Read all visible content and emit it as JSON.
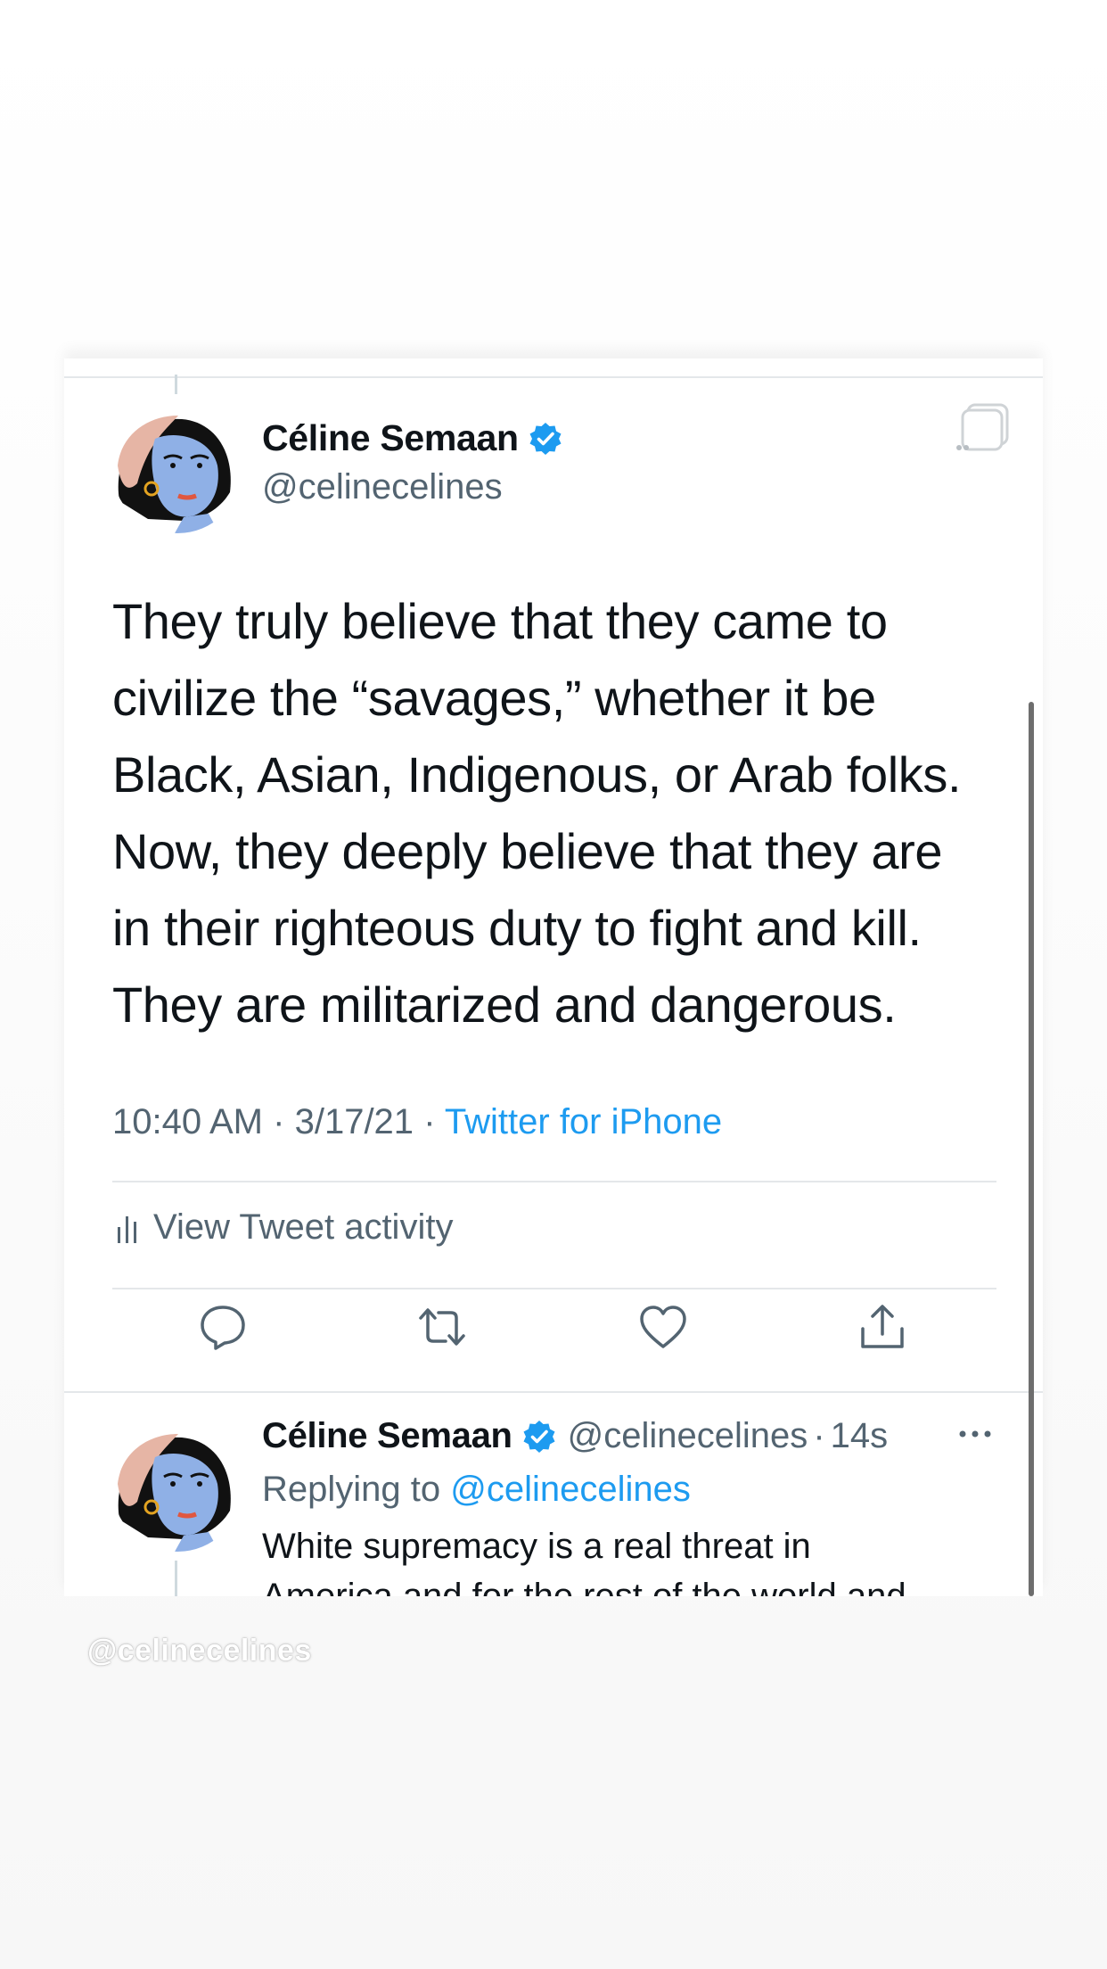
{
  "main_tweet": {
    "author": {
      "display_name": "Céline Semaan",
      "handle": "@celinecelines",
      "verified": true,
      "avatar_icon": "illustrated-portrait-avatar"
    },
    "text_lines": [
      "They truly believe that they came to",
      "civilize the “savages,” whether it be",
      "Black, Asian, Indigenous, or Arab folks.",
      "Now, they deeply believe that they are",
      "in their righteous duty to fight and kill.",
      "They are militarized and dangerous."
    ],
    "time": "10:40 AM",
    "date": "3/17/21",
    "separator": "·",
    "source": "Twitter for iPhone",
    "activity_label": "View Tweet activity",
    "actions": [
      "reply-icon",
      "retweet-icon",
      "like-icon",
      "share-icon"
    ]
  },
  "reply_tweet": {
    "author": {
      "display_name": "Céline Semaan",
      "handle": "@celinecelines",
      "verified": true
    },
    "separator": "·",
    "time_ago": "14s",
    "replying_prefix": "Replying to",
    "replying_to": "@celinecelines",
    "text_visible": "White supremacy is a real threat in",
    "text_cut": "America and for the rest of the world and"
  },
  "watermark": "@celinecelines",
  "colors": {
    "accent": "#1d9bf0",
    "secondary_text": "#536471",
    "primary_text": "#0f1419",
    "divider": "#e4e7ea"
  }
}
